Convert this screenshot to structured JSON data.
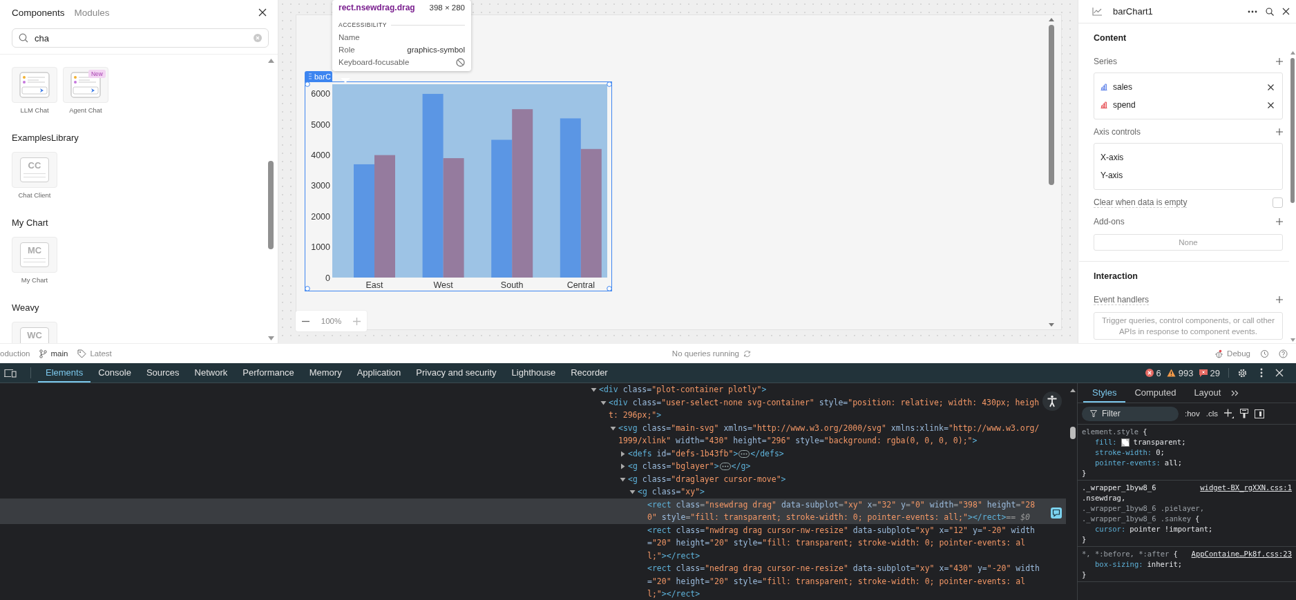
{
  "left_panel": {
    "tabs": [
      {
        "label": "Components",
        "selected": true
      },
      {
        "label": "Modules",
        "selected": false
      }
    ],
    "search": {
      "value": "cha"
    },
    "sections": [
      {
        "items": [
          {
            "label": "LLM Chat",
            "kind": "chat"
          },
          {
            "label": "Agent Chat",
            "kind": "chat",
            "badge": "New"
          }
        ]
      },
      {
        "title": "ExamplesLibrary",
        "items": [
          {
            "label": "Chat Client",
            "kind": "monogram",
            "monogram": "CC"
          }
        ]
      },
      {
        "title": "My Chart",
        "items": [
          {
            "label": "My Chart",
            "kind": "monogram",
            "monogram": "MC"
          }
        ]
      },
      {
        "title": "Weavy",
        "items": [
          {
            "kind": "monogram",
            "monogram": "WC"
          }
        ]
      }
    ]
  },
  "canvas": {
    "widget_label": "barC",
    "zoom": "100%",
    "tooltip": {
      "selector": "rect.nsewdrag.drag",
      "size": "398 × 280",
      "section": "ACCESSIBILITY",
      "rows": [
        {
          "label": "Name"
        },
        {
          "label": "Role",
          "value": "graphics-symbol"
        },
        {
          "label": "Keyboard-focusable",
          "focusable": false
        }
      ]
    },
    "chart_data": {
      "type": "bar",
      "categories": [
        "East",
        "West",
        "South",
        "Central"
      ],
      "series": [
        {
          "color": "#5b96e4",
          "values": [
            3700,
            6000,
            4500,
            5200
          ]
        },
        {
          "color": "#957b9e",
          "values": [
            4000,
            3900,
            5500,
            4200
          ]
        }
      ],
      "ylim": [
        0,
        6315
      ],
      "yticks": [
        0,
        1000,
        2000,
        3000,
        4000,
        5000,
        6000
      ]
    }
  },
  "inspector": {
    "title": "barChart1",
    "content_heading": "Content",
    "series_label": "Series",
    "series": [
      {
        "name": "sales",
        "color": "#5b7fe8"
      },
      {
        "name": "spend",
        "color": "#e5484d"
      }
    ],
    "axis_label": "Axis controls",
    "axes": [
      "X-axis",
      "Y-axis"
    ],
    "clear_option": {
      "label": "Clear when data is empty",
      "checked": false
    },
    "addons_label": "Add-ons",
    "addons_empty": "None",
    "interaction_heading": "Interaction",
    "event_label": "Event handlers",
    "event_hint": "Trigger queries, control components, or call other APIs in response to component events."
  },
  "status_bar": {
    "environment": "oduction",
    "branch": "main",
    "release": "Latest",
    "queries": "No queries running",
    "debug": "Debug"
  },
  "devtools": {
    "tabs": [
      {
        "label": "Elements",
        "selected": true
      },
      {
        "label": "Console",
        "selected": false
      },
      {
        "label": "Sources",
        "selected": false
      },
      {
        "label": "Network",
        "selected": false
      },
      {
        "label": "Performance",
        "selected": false
      },
      {
        "label": "Memory",
        "selected": false
      },
      {
        "label": "Application",
        "selected": false
      },
      {
        "label": "Privacy and security",
        "selected": false
      },
      {
        "label": "Lighthouse",
        "selected": false
      },
      {
        "label": "Recorder",
        "selected": false
      }
    ],
    "errors": "6",
    "warnings": "993",
    "issues": "29",
    "tree": [
      {
        "open": "<div class=\"plot-container plotly\">",
        "expanded": true,
        "selected": false,
        "children": [
          {
            "open": "<div class=\"user-select-none svg-container\" style=\"position: relative; width: 430px; height: 296px;\">",
            "expanded": true,
            "selected": false,
            "children": [
              {
                "open": "<svg class=\"main-svg\" xmlns=\"http://www.w3.org/2000/svg\" xmlns:xlink=\"http://www.w3.org/1999/xlink\" width=\"430\" height=\"296\" style=\"background: rgba(0, 0, 0, 0);\">",
                "expanded": true,
                "selected": false,
                "children": [
                  {
                    "open": "<defs id=\"defs-1b43fb\">",
                    "close": "</defs>",
                    "expanded": false,
                    "selected": false
                  },
                  {
                    "open": "<g class=\"bglayer\">",
                    "close": "</g>",
                    "expanded": false,
                    "selected": false
                  },
                  {
                    "open": "<g class=\"draglayer cursor-move\">",
                    "expanded": true,
                    "selected": false,
                    "children": [
                      {
                        "open": "<g class=\"xy\">",
                        "expanded": true,
                        "selected": false,
                        "children": [
                          {
                            "open": "<rect class=\"nsewdrag drag\" data-subplot=\"xy\" x=\"32\" y=\"0\" width=\"398\" height=\"280\" style=\"fill: transparent; stroke-width: 0; pointer-events: all;\">",
                            "close": "</rect>",
                            "selected": true,
                            "marker": "== $0"
                          },
                          {
                            "open": "<rect class=\"nwdrag drag cursor-nw-resize\" data-subplot=\"xy\" x=\"12\" y=\"-20\" width=\"20\" height=\"20\" style=\"fill: transparent; stroke-width: 0; pointer-events: all;\">",
                            "close": "</rect>",
                            "selected": false
                          },
                          {
                            "open": "<rect class=\"nedrag drag cursor-ne-resize\" data-subplot=\"xy\" x=\"430\" y=\"-20\" width=\"20\" height=\"20\" style=\"fill: transparent; stroke-width: 0; pointer-events: all;\">",
                            "close": "</rect>",
                            "selected": false
                          }
                        ]
                      }
                    ]
                  }
                ]
              }
            ]
          }
        ]
      }
    ],
    "styles": {
      "tabs": [
        {
          "label": "Styles",
          "selected": true
        },
        {
          "label": "Computed",
          "selected": false
        },
        {
          "label": "Layout",
          "selected": false
        }
      ],
      "filter_placeholder": "Filter",
      "hov": ":hov",
      "cls": ".cls",
      "rules": [
        {
          "selectors": [
            {
              "text": "element.style",
              "matched": false
            }
          ],
          "open": "{",
          "close": "}",
          "declarations": [
            {
              "property": "fill:",
              "value": "transparent;",
              "swatch": true
            },
            {
              "property": "stroke-width:",
              "value": "0;"
            },
            {
              "property": "pointer-events:",
              "value": "all;"
            }
          ]
        },
        {
          "selectors": [
            {
              "text": "._wrapper_1byw8_6 .nsewdrag,",
              "matched": true
            },
            {
              "text": "._wrapper_1byw8_6 .pielayer,",
              "matched": false
            },
            {
              "text": "._wrapper_1byw8_6 .sankey",
              "matched": false
            }
          ],
          "source": "widget-BX_rgXXN.css:1",
          "open": "{",
          "close": "}",
          "declarations": [
            {
              "property": "cursor:",
              "value": "pointer !important;"
            }
          ]
        },
        {
          "selectors": [
            {
              "text": "*, *:before, *:after",
              "matched": false
            }
          ],
          "source": "AppContaine…Pk8f.css:23",
          "open": "{",
          "close": "}",
          "declarations": [
            {
              "property": "box-sizing:",
              "value": "inherit;"
            }
          ]
        }
      ]
    }
  }
}
